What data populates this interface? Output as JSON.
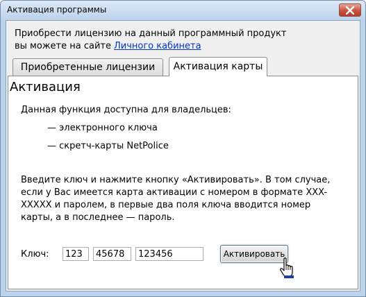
{
  "window": {
    "title": "Активация программы"
  },
  "intro": {
    "line1": "Приобрести лицензию на данный программный продукт",
    "line2_prefix": "вы можете на сайте",
    "link": "Личного кабинета"
  },
  "tabs": [
    {
      "label": "Приобретенные лицензии",
      "active": false
    },
    {
      "label": "Активация карты",
      "active": true
    }
  ],
  "panel": {
    "heading": "Активация",
    "availability": "Данная функция доступна для владельцев:",
    "bullets": [
      "— электронного ключа",
      "— скретч-карты NetPolice"
    ],
    "instructions": "Введите ключ и нажмите кнопку «Активировать». В том случае, если у Вас имеется карта активации с номером в формате XXX-XXXXX и паролем, в первые два поля ключа вводится номер карты, а в последнее — пароль.",
    "key_label": "Ключ:",
    "key_fields": [
      "123",
      "45678",
      "123456"
    ],
    "activate_label": "Активировать"
  },
  "icons": {
    "close": "close-icon",
    "cursor": "hand-pointer-cursor-icon"
  },
  "colors": {
    "link": "#0033cc",
    "close_button": "#c7523e",
    "frame": "#bcd3ec"
  }
}
